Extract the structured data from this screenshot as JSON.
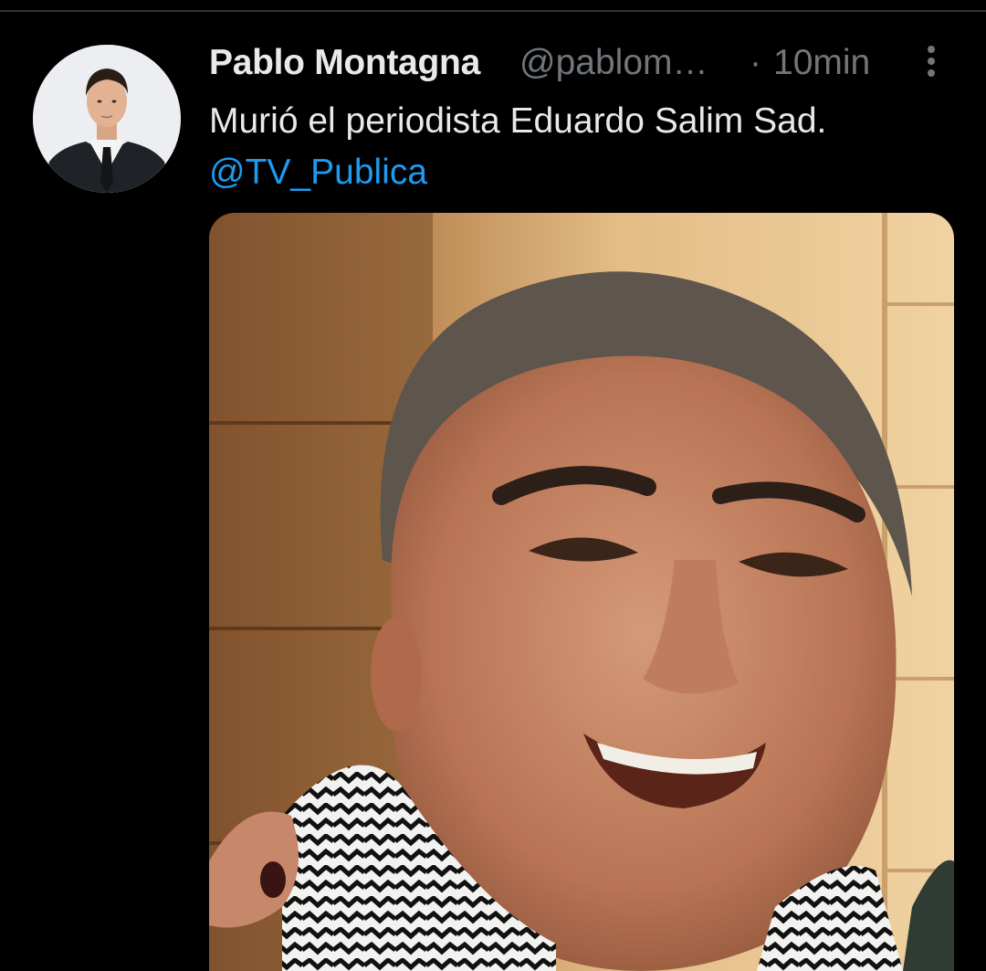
{
  "tweet": {
    "author": {
      "display_name": "Pablo Montagna",
      "handle": "@pablom…",
      "avatar": "profile-photo"
    },
    "separator": "·",
    "time": "10min",
    "more_icon": "vertical-ellipsis-icon",
    "text": {
      "line1": "Murió el periodista Eduardo Salim Sad.",
      "mention": "@TV_Publica"
    },
    "media": {
      "kind": "photo"
    }
  },
  "colors": {
    "background": "#000000",
    "text_primary": "#e7e9ea",
    "text_secondary": "#71767b",
    "link": "#1d9bf0"
  }
}
